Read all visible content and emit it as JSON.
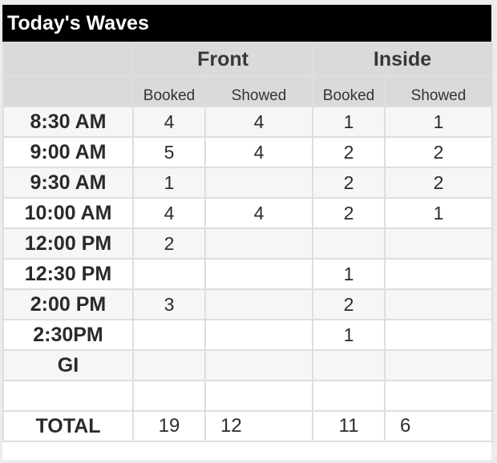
{
  "title": "Today's Waves",
  "groups": [
    "Front",
    "Inside"
  ],
  "subheaders": [
    "Booked",
    "Showed",
    "Booked",
    "Showed"
  ],
  "rows": [
    {
      "time": "8:30 AM",
      "front_booked": "4",
      "front_showed": "4",
      "inside_booked": "1",
      "inside_showed": "1"
    },
    {
      "time": "9:00 AM",
      "front_booked": "5",
      "front_showed": "4",
      "inside_booked": "2",
      "inside_showed": "2"
    },
    {
      "time": "9:30 AM",
      "front_booked": "1",
      "front_showed": "",
      "inside_booked": "2",
      "inside_showed": "2"
    },
    {
      "time": "10:00 AM",
      "front_booked": "4",
      "front_showed": "4",
      "inside_booked": "2",
      "inside_showed": "1"
    },
    {
      "time": "12:00 PM",
      "front_booked": "2",
      "front_showed": "",
      "inside_booked": "",
      "inside_showed": ""
    },
    {
      "time": "12:30 PM",
      "front_booked": "",
      "front_showed": "",
      "inside_booked": "1",
      "inside_showed": ""
    },
    {
      "time": "2:00 PM",
      "front_booked": "3",
      "front_showed": "",
      "inside_booked": "2",
      "inside_showed": ""
    },
    {
      "time": "2:30PM",
      "front_booked": "",
      "front_showed": "",
      "inside_booked": "1",
      "inside_showed": ""
    },
    {
      "time": "GI",
      "front_booked": "",
      "front_showed": "",
      "inside_booked": "",
      "inside_showed": ""
    },
    {
      "time": "",
      "front_booked": "",
      "front_showed": "",
      "inside_booked": "",
      "inside_showed": ""
    }
  ],
  "total": {
    "label": "TOTAL",
    "front_booked": "19",
    "front_showed": "12",
    "inside_booked": "11",
    "inside_showed": "6"
  }
}
